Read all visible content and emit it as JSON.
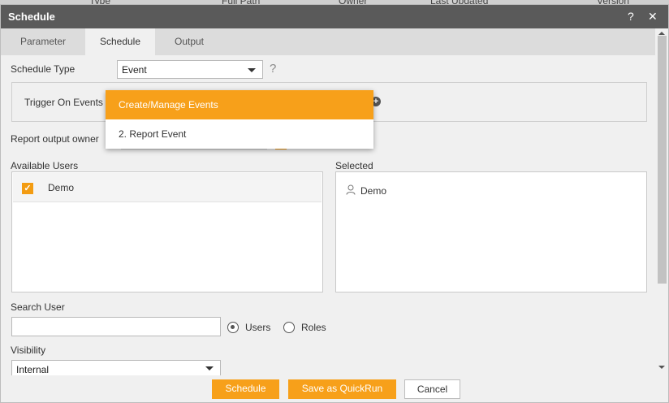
{
  "background": {
    "columns": [
      "Type",
      "Full Path",
      "Owner",
      "Last Updated",
      "Version"
    ]
  },
  "dialog": {
    "title": "Schedule",
    "help_glyph": "?",
    "close_glyph": "✕"
  },
  "tabs": [
    {
      "label": "Parameter",
      "active": false
    },
    {
      "label": "Schedule",
      "active": true
    },
    {
      "label": "Output",
      "active": false
    }
  ],
  "schedule_type": {
    "label": "Schedule Type",
    "value": "Event",
    "help_glyph": "?"
  },
  "trigger": {
    "label": "Trigger On Events",
    "add_glyph": "+"
  },
  "events_dropdown": {
    "items": [
      "Create/Manage Events",
      "2. Report Event"
    ],
    "highlighted_index": 0
  },
  "owner": {
    "label": "Report output owner"
  },
  "available_users": {
    "label": "Available Users",
    "items": [
      {
        "name": "Demo",
        "checked": true
      }
    ],
    "check_glyph": "✓"
  },
  "selected_users": {
    "label": "Selected",
    "items": [
      "Demo"
    ]
  },
  "search": {
    "label": "Search User",
    "value": "",
    "placeholder": "",
    "options": [
      {
        "label": "Users",
        "selected": true
      },
      {
        "label": "Roles",
        "selected": false
      }
    ]
  },
  "visibility": {
    "label": "Visibility",
    "value": "Internal"
  },
  "footer": {
    "schedule_label": "Schedule",
    "quickrun_label": "Save as QuickRun",
    "cancel_label": "Cancel"
  },
  "colors": {
    "accent": "#f7a01a",
    "titlebar": "#5a5a5a"
  }
}
